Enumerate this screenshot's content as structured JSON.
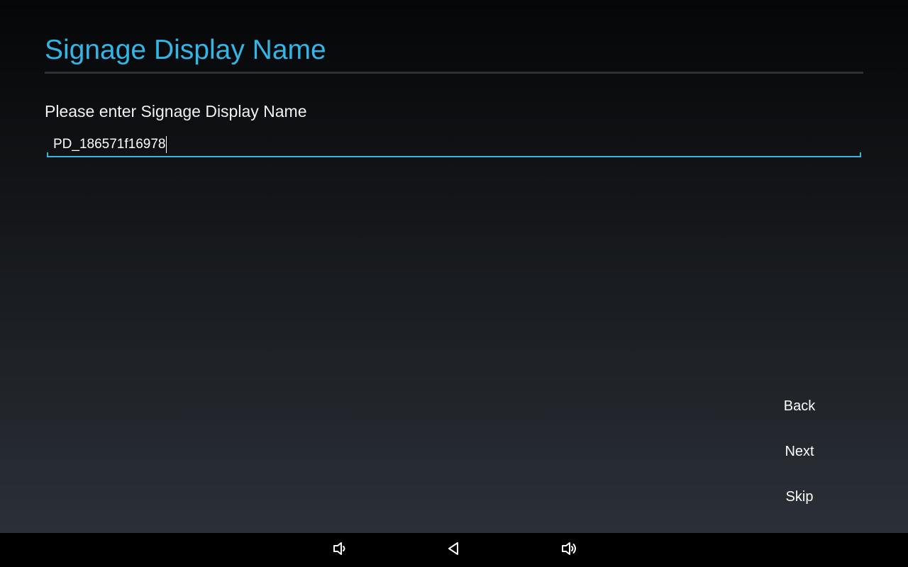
{
  "page": {
    "title": "Signage Display Name",
    "prompt": "Please enter Signage Display Name"
  },
  "name_input": {
    "value": "PD_186571f16978"
  },
  "actions": {
    "back_label": "Back",
    "next_label": "Next",
    "skip_label": "Skip"
  },
  "navbar": {
    "items": [
      "volume-down-icon",
      "back-icon",
      "volume-up-icon"
    ]
  },
  "colors": {
    "accent": "#33b5e5",
    "text": "#ffffff",
    "navbar": "#000000"
  }
}
